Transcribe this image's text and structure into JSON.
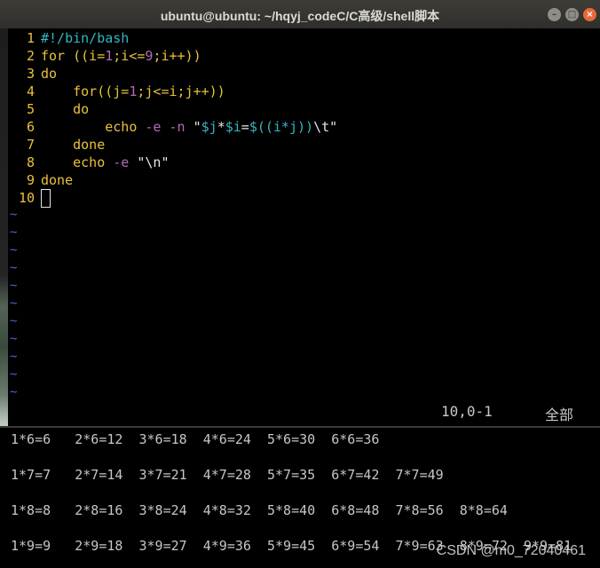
{
  "window": {
    "title": "ubuntu@ubuntu: ~/hqyj_codeC/C高级/shell脚本",
    "min_glyph": "–",
    "max_glyph": "□",
    "close_glyph": "×"
  },
  "editor": {
    "line_numbers": [
      "1",
      "2",
      "3",
      "4",
      "5",
      "6",
      "7",
      "8",
      "9",
      "10"
    ],
    "lines": {
      "l1": "#!/bin/bash",
      "l2_a": "for ((i=",
      "l2_b": "1",
      "l2_c": ";i<=",
      "l2_d": "9",
      "l2_e": ";i++))",
      "l3": "do",
      "l4_a": "    for((j=",
      "l4_b": "1",
      "l4_c": ";j<=i;j++))",
      "l5": "    do",
      "l6_a": "        echo ",
      "l6_b": "-e -n ",
      "l6_c": "\"",
      "l6_d": "$j",
      "l6_e": "*",
      "l6_f": "$i",
      "l6_g": "=",
      "l6_h": "$((i*j))",
      "l6_i": "\\t",
      "l6_j": "\"",
      "l7": "    done",
      "l8_a": "    echo ",
      "l8_b": "-e ",
      "l8_c": "\"\\n\"",
      "l9": "done"
    },
    "tilde": "~",
    "status_position": "10,0-1",
    "status_scroll": "全部"
  },
  "output": {
    "rows": [
      "1*6=6   2*6=12  3*6=18  4*6=24  5*6=30  6*6=36",
      "1*7=7   2*7=14  3*7=21  4*7=28  5*7=35  6*7=42  7*7=49",
      "1*8=8   2*8=16  3*8=24  4*8=32  5*8=40  6*8=48  7*8=56  8*8=64",
      "1*9=9   2*9=18  3*9=27  4*9=36  5*9=45  6*9=54  7*9=63  8*9=72  9*9=81"
    ]
  },
  "watermark": "CSDN @m0_72040461",
  "colors": {
    "keyword": "#e8c23b",
    "string_var": "#34b6c4",
    "option": "#b36bb3",
    "tilde": "#4a64d7"
  }
}
